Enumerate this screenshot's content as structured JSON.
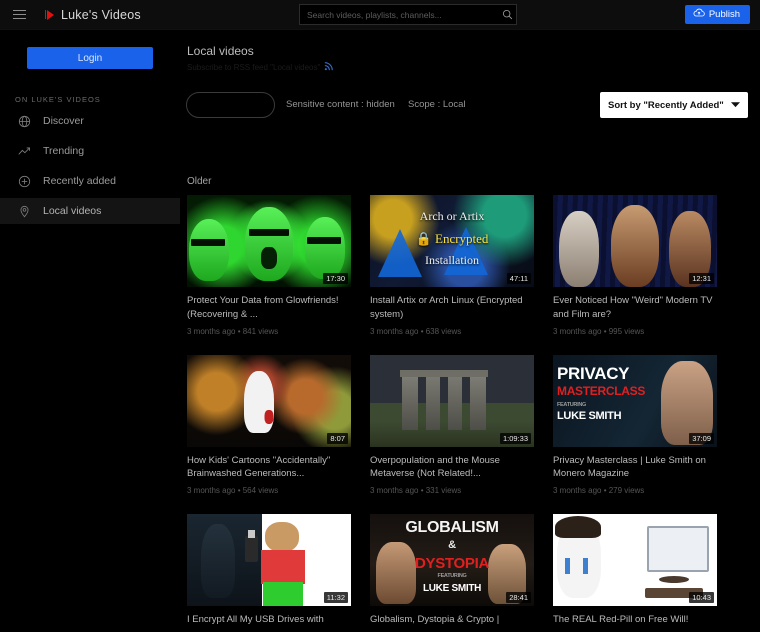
{
  "topbar": {
    "menu_icon": "hamburger-menu-icon",
    "brand_name": "Luke's Videos",
    "brand_logo_icon": "play-logo-icon",
    "search_placeholder": "Search videos, playlists, channels...",
    "search_value": "",
    "search_icon": "search-icon",
    "publish_label": "Publish",
    "publish_icon": "upload-cloud-icon",
    "publish_color": "#1a62ea"
  },
  "sidebar": {
    "login_label": "Login",
    "section_title": "ON LUKE'S VIDEOS",
    "items": [
      {
        "label": "Discover",
        "icon": "globe-icon",
        "active": false
      },
      {
        "label": "Trending",
        "icon": "trending-up-icon",
        "active": false
      },
      {
        "label": "Recently added",
        "icon": "plus-circle-icon",
        "active": false
      },
      {
        "label": "Local videos",
        "icon": "location-pin-icon",
        "active": true
      }
    ]
  },
  "main": {
    "page_title": "Local videos",
    "rss_label": "Subscribe to RSS feed \"Local videos\"",
    "rss_icon": "rss-icon",
    "filters_pill_label": "",
    "sensitive_filter": "Sensitive content : hidden",
    "scope_filter": "Scope : Local",
    "sort_label": "Sort by \"Recently Added\"",
    "sort_chevron_icon": "chevron-down-icon",
    "group_title": "Older"
  },
  "videos": [
    {
      "title": "Protect Your Data from Glowfriends! (Recovering & ...",
      "duration": "17:30",
      "meta": "3 months ago • 841 views",
      "art": "art-glow"
    },
    {
      "title": "Install Artix or Arch Linux (Encrypted system)",
      "duration": "47:11",
      "meta": "3 months ago • 638 views",
      "art": "art-arch"
    },
    {
      "title": "Ever Noticed How \"Weird\" Modern TV and Film are?",
      "duration": "12:31",
      "meta": "3 months ago • 995 views",
      "art": "art-tv"
    },
    {
      "title": "How Kids' Cartoons \"Accidentally\" Brainwashed Generations...",
      "duration": "8:07",
      "meta": "3 months ago • 564 views",
      "art": "art-cartoon"
    },
    {
      "title": "Overpopulation and the Mouse Metaverse (Not Related!...",
      "duration": "1:09:33",
      "meta": "3 months ago • 331 views",
      "art": "art-stones"
    },
    {
      "title": "Privacy Masterclass | Luke Smith on Monero Magazine",
      "duration": "37:09",
      "meta": "3 months ago • 279 views",
      "art": "art-privacy"
    },
    {
      "title": "I Encrypt All My USB Drives with",
      "duration": "11:32",
      "meta": "",
      "art": "art-usb"
    },
    {
      "title": "Globalism, Dystopia & Crypto |",
      "duration": "28:41",
      "meta": "",
      "art": "art-glob"
    },
    {
      "title": "The REAL Red-Pill on Free Will!",
      "duration": "10:43",
      "meta": "",
      "art": "art-redpill"
    }
  ]
}
